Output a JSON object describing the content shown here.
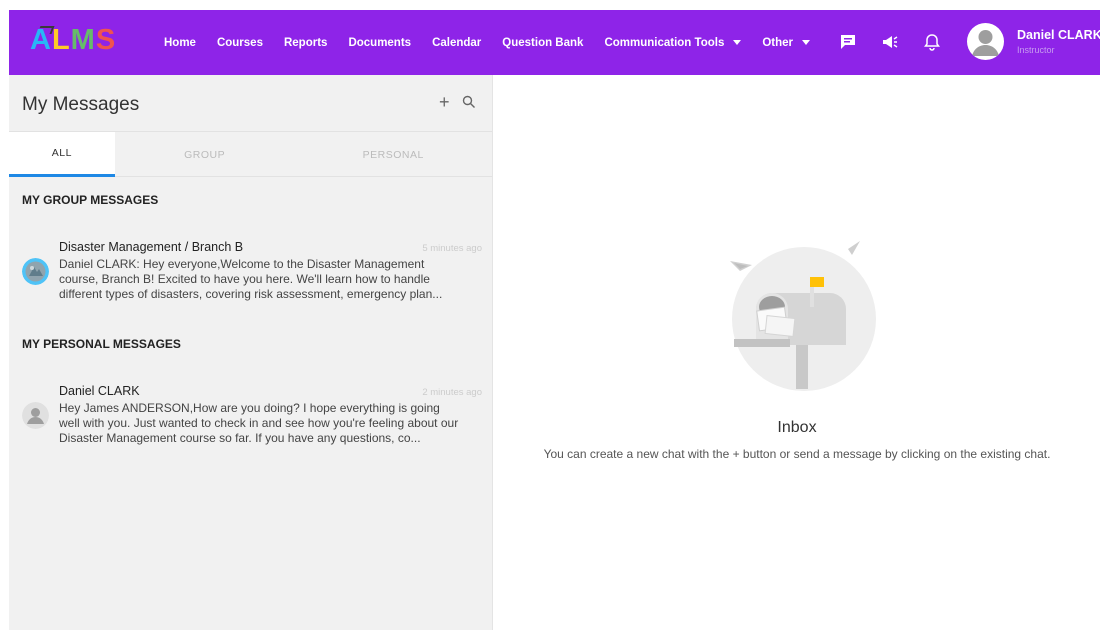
{
  "app": {
    "logo_letters": [
      "A",
      "L",
      "M",
      "S"
    ]
  },
  "nav": {
    "items": [
      {
        "label": "Home"
      },
      {
        "label": "Courses"
      },
      {
        "label": "Reports"
      },
      {
        "label": "Documents"
      },
      {
        "label": "Calendar"
      },
      {
        "label": "Question Bank"
      },
      {
        "label": "Communication Tools",
        "dropdown": true
      },
      {
        "label": "Other",
        "dropdown": true
      }
    ]
  },
  "header_icons": [
    "chat-icon",
    "megaphone-icon",
    "bell-icon"
  ],
  "user": {
    "name": "Daniel CLARK",
    "role": "Instructor"
  },
  "messages_panel": {
    "title": "My Messages",
    "add_label": "+",
    "tabs": [
      {
        "label": "ALL",
        "active": true
      },
      {
        "label": "GROUP",
        "active": false
      },
      {
        "label": "PERSONAL",
        "active": false
      }
    ],
    "group_section_title": "MY GROUP MESSAGES",
    "personal_section_title": "MY PERSONAL MESSAGES",
    "group_messages": [
      {
        "title": "Disaster Management / Branch B",
        "time": "5 minutes ago",
        "text": "Daniel CLARK: Hey everyone,Welcome to the Disaster Management course, Branch B! Excited to have you here. We'll learn how to handle different types of disasters, covering risk assessment, emergency plan..."
      }
    ],
    "personal_messages": [
      {
        "title": "Daniel CLARK",
        "time": "2 minutes ago",
        "text": "Hey James ANDERSON,How are you doing? I hope everything is going well with you. Just wanted to check in and see how you're feeling about our Disaster Management course so far. If you have any questions, co..."
      }
    ]
  },
  "empty_state": {
    "title": "Inbox",
    "description": "You can create a new chat with the + button or send a message by clicking on the existing chat."
  },
  "colors": {
    "topbar": "#8e24e8",
    "tab_active_underline": "#1e88e5",
    "left_panel_bg": "#f1f1f1"
  }
}
